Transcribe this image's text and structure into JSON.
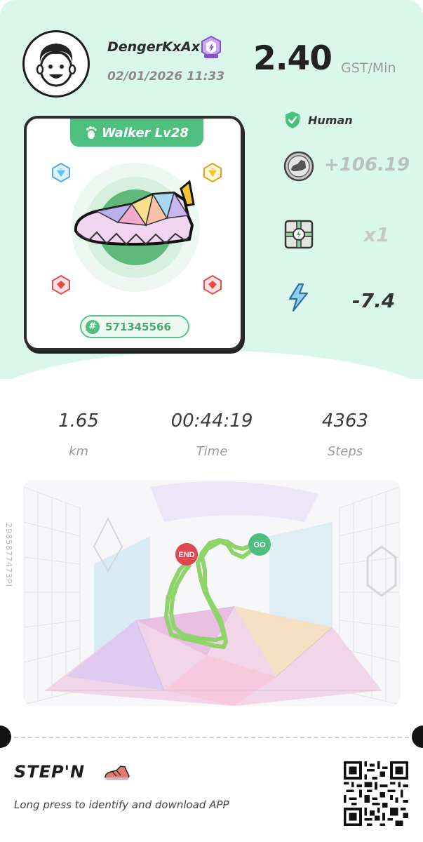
{
  "user": {
    "name": "DengerKxAx",
    "datetime": "02/01/2026 11:33",
    "badge_icon": "rank-badge-icon"
  },
  "rate": {
    "value": "2.40",
    "unit": "GST/Min"
  },
  "sneaker": {
    "level_label": "Walker Lv28",
    "id_prefix": "#",
    "id": "571345566",
    "gems": [
      "blue-gem-icon",
      "yellow-gem-icon",
      "red-gem-icon",
      "red-gem-icon"
    ]
  },
  "status": {
    "human_label": "Human",
    "gst_earned": "+106.19",
    "mystery_box_count": "x1",
    "energy": "-7.4"
  },
  "activity": {
    "distance_value": "1.65",
    "distance_label": "km",
    "time_value": "00:44:19",
    "time_label": "Time",
    "steps_value": "4363",
    "steps_label": "Steps"
  },
  "map": {
    "end_label": "END",
    "go_label": "GO",
    "side_code": "2985877473PI"
  },
  "footer": {
    "logo": "STEP'N",
    "prompt": "Long press to identify and download APP"
  },
  "colors": {
    "mint": "#dbf7ec",
    "accent_green": "#4fbf7f",
    "route": "#8fd46b",
    "end_red": "#e0474e",
    "go_green": "#4fbf7f"
  }
}
